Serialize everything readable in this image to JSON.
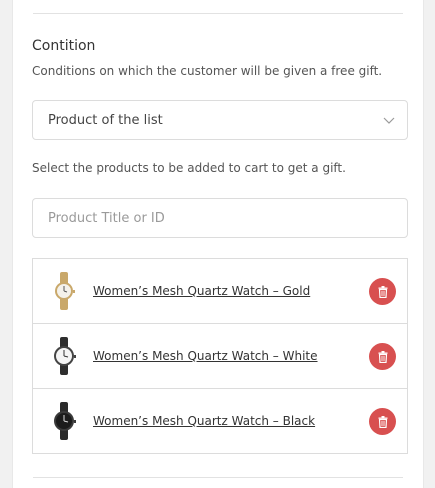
{
  "condition": {
    "title": "Contition",
    "description": "Conditions on which the customer will be given a free gift.",
    "select_value": "Product of the list",
    "helper_text": "Select the products to be added to cart to get a gift.",
    "search_placeholder": "Product Title or ID"
  },
  "products": [
    {
      "title": "Women’s Mesh Quartz Watch – Gold",
      "strap_color": "#c9a86a",
      "dial_color": "#f4f1ea"
    },
    {
      "title": "Women’s Mesh Quartz Watch – White",
      "strap_color": "#2e2e2e",
      "dial_color": "#f5f5f5"
    },
    {
      "title": "Women’s Mesh Quartz Watch – Black",
      "strap_color": "#2a2a2a",
      "dial_color": "#1c1c1c"
    }
  ],
  "colors": {
    "delete_button": "#d85050",
    "border": "#dcdcdc"
  },
  "icons": {
    "select": "chevron-down-icon",
    "delete": "trash-icon",
    "thumbnail": "watch-icon"
  }
}
